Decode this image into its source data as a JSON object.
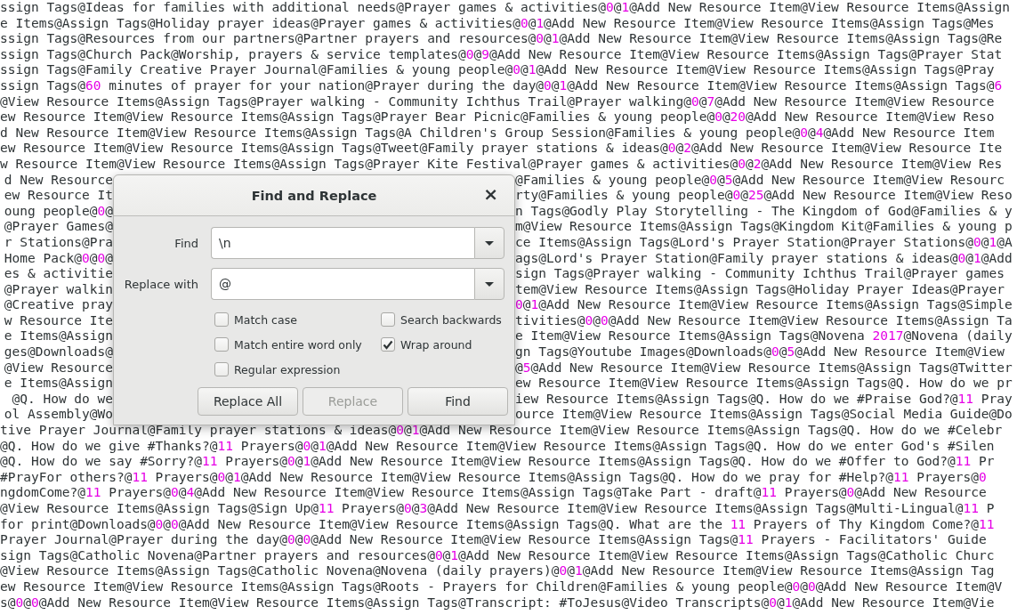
{
  "editor": {
    "lines": [
      {
        "text": "ssign Tags@Ideas for families with additional needs@Prayer games & activities@0@1@Add New Resource Item@View Resource Items@Assign"
      },
      {
        "text": "e Items@Assign Tags@Holiday prayer ideas@Prayer games & activities@0@1@Add New Resource Item@View Resource Items@Assign Tags@Mes"
      },
      {
        "text": "ssign Tags@Resources from our partners@Partner prayers and resources@0@1@Add New Resource Item@View Resource Items@Assign Tags@Re"
      },
      {
        "text": "ssign Tags@Church Pack@Worship, prayers & service templates@0@9@Add New Resource Item@View Resource Items@Assign Tags@Prayer Stat"
      },
      {
        "text": "ssign Tags@Family Creative Prayer Journal@Families & young people@0@1@Add New Resource Item@View Resource Items@Assign Tags@Pray"
      },
      {
        "text": "ssign Tags@60 minutes of prayer for your nation@Prayer during the day@0@1@Add New Resource Item@View Resource Items@Assign Tags@6"
      },
      {
        "text": "@View Resource Items@Assign Tags@Prayer walking - Community Ichthus Trail@Prayer walking@0@7@Add New Resource Item@View Resource"
      },
      {
        "text": "ew Resource Item@View Resource Items@Assign Tags@Prayer Bear Picnic@Families & young people@0@20@Add New Resource Item@View Reso"
      },
      {
        "text": "d New Resource Item@View Resource Items@Assign Tags@A Children's Group Session@Families & young people@0@4@Add New Resource Item"
      },
      {
        "text": "ew Resource Item@View Resource Items@Assign Tags@Tweet@Family prayer stations & ideas@0@2@Add New Resource Item@View Resource Ite"
      },
      {
        "text": "w Resource Item@View Resource Items@Assign Tags@Prayer Kite Festival@Prayer games & activities@0@2@Add New Resource Item@View Res"
      },
      {
        "left": "d New Resource",
        "right": "@Families & young people@0@5@Add New Resource Item@View Resourc"
      },
      {
        "left": "ew Resource It",
        "right": "rty@Families & young people@0@25@Add New Resource Item@View Reso"
      },
      {
        "left": "oung people@0@",
        "right": "n Tags@Godly Play Storytelling - The Kingdom of God@Families & y"
      },
      {
        "left": "@Prayer Games@",
        "right": "m@View Resource Items@Assign Tags@Kingdom Kit@Families & young p"
      },
      {
        "left": "r Stations@Pra",
        "right": "ce Items@Assign Tags@Lord's Prayer Station@Prayer Stations@0@1@A"
      },
      {
        "left": "Home Pack@0@0@",
        "right": "ags@Lord's Prayer Station@Family prayer stations & ideas@0@1@Add"
      },
      {
        "left": "es & activitie",
        "right": "sign Tags@Prayer walking - Community Ichthus Trail@Prayer games"
      },
      {
        "left": "@Prayer walkin",
        "right": "tem@View Resource Items@Assign Tags@Holiday Prayer Ideas@Prayer"
      },
      {
        "left": "@Creative pray",
        "right": "0@1@Add New Resource Item@View Resource Items@Assign Tags@Simple"
      },
      {
        "left": "w Resource Ite",
        "right": "tivities@0@0@Add New Resource Item@View Resource Items@Assign Ta"
      },
      {
        "left": "e Items@Assign",
        "right": "e Item@View Resource Items@Assign Tags@Novena 2017@Novena (daily"
      },
      {
        "left": "ges@Downloads@",
        "right": "gn Tags@Youtube Images@Downloads@0@5@Add New Resource Item@View"
      },
      {
        "left": "@View Resource",
        "right": "@5@Add New Resource Item@View Resource Items@Assign Tags@Twitter"
      },
      {
        "left": "e Items@Assign",
        "right": "ew Resource Item@View Resource Items@Assign Tags@Q. How do we pr"
      },
      {
        "left": "@Q. How do we",
        "right": "iew Resource Items@Assign Tags@Q. How do we #Praise God?@11 Pray"
      },
      {
        "left": "ol Assembly@Wo",
        "right": "ource Item@View Resource Items@Assign Tags@Social Media Guide@Do"
      },
      {
        "text": "tive Prayer Journal@Family prayer stations & ideas@0@1@Add New Resource Item@View Resource Items@Assign Tags@Q. How do we #Celebr"
      },
      {
        "text": "@Q. How do we give #Thanks?@11 Prayers@0@1@Add New Resource Item@View Resource Items@Assign Tags@Q. How do we enter God's #Silen"
      },
      {
        "text": "@Q. How do we say #Sorry?@11 Prayers@0@1@Add New Resource Item@View Resource Items@Assign Tags@Q. How do we #Offer to God?@11 Pr"
      },
      {
        "text": "#PrayFor others?@11 Prayers@0@1@Add New Resource Item@View Resource Items@Assign Tags@Q. How do we pray for #Help?@11 Prayers@0"
      },
      {
        "text": "ngdomCome?@11 Prayers@0@4@Add New Resource Item@View Resource Items@Assign Tags@Take Part - draft@11 Prayers@0@Add New Resource"
      },
      {
        "text": "@View Resource Items@Assign Tags@Sign Up@11 Prayers@0@3@Add New Resource Item@View Resource Items@Assign Tags@Multi-Lingual@11 P"
      },
      {
        "text": "for print@Downloads@0@0@Add New Resource Item@View Resource Items@Assign Tags@Q. What are the 11 Prayers of Thy Kingdom Come?@11"
      },
      {
        "text": "Prayer Journal@Prayer during the day@0@0@Add New Resource Item@View Resource Items@Assign Tags@11 Prayers - Facilitators' Guide"
      },
      {
        "text": "sign Tags@Catholic Novena@Partner prayers and resources@0@1@Add New Resource Item@View Resource Items@Assign Tags@Catholic Churc"
      },
      {
        "text": "@View Resource Items@Assign Tags@Catholic Novena@Novena (daily prayers)@0@1@Add New Resource Item@View Resource Items@Assign Tag"
      },
      {
        "text": "ew Resource Item@View Resource Items@Assign Tags@Roots - Prayers for Children@Families & young people@0@0@Add New Resource Item@V"
      },
      {
        "text": "s@0@0@Add New Resource Item@View Resource Items@Assign Tags@Transcript: #ToJesus@Video Transcripts@0@1@Add New Resource Item@Vie"
      }
    ]
  },
  "dialog": {
    "title": "Find and Replace",
    "close": "×",
    "fields": [
      {
        "label": "Find",
        "value": "\\n"
      },
      {
        "label": "Replace with",
        "value": "@"
      }
    ],
    "options": [
      {
        "label": "Match case",
        "checked": false
      },
      {
        "label": "Search backwards",
        "checked": false
      },
      {
        "label": "Match entire word only",
        "checked": false
      },
      {
        "label": "Wrap around",
        "checked": true
      },
      {
        "label": "Regular expression",
        "checked": false
      }
    ],
    "buttons": [
      {
        "label": "Replace All",
        "disabled": false
      },
      {
        "label": "Replace",
        "disabled": true
      },
      {
        "label": "Find",
        "disabled": false
      }
    ]
  }
}
